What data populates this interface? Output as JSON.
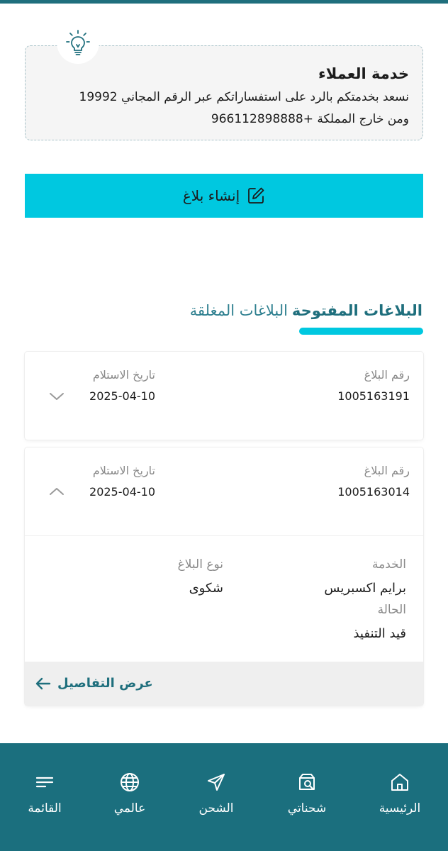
{
  "customer_service": {
    "title": "خدمة العملاء",
    "line1": "نسعد بخدمتكم بالرد على استفساراتكم عبر الرقم المجاني 19992",
    "line2": "ومن خارج المملكة +966112898888"
  },
  "create_button": {
    "label": "إنشاء بلاغ"
  },
  "tabs": [
    {
      "label": "البلاغات المفتوحة",
      "active": true
    },
    {
      "label": "البلاغات المغلقة",
      "active": false
    }
  ],
  "reports": [
    {
      "number_label": "رقم البلاغ",
      "number": "1005163191",
      "date_label": "تاريخ الاستلام",
      "date": "2025-04-10",
      "expanded": false
    },
    {
      "number_label": "رقم البلاغ",
      "number": "1005163014",
      "date_label": "تاريخ الاستلام",
      "date": "2025-04-10",
      "expanded": true,
      "service_label": "الخدمة",
      "service": "برايم اكسبريس",
      "type_label": "نوع البلاغ",
      "type": "شكوى",
      "status_label": "الحالة",
      "status": "قيد التنفيذ",
      "details_label": "عرض التفاصيل"
    }
  ],
  "bottom_nav": [
    {
      "label": "الرئيسية",
      "icon": "home-icon"
    },
    {
      "label": "شحناتي",
      "icon": "box-search-icon"
    },
    {
      "label": "الشحن",
      "icon": "send-icon"
    },
    {
      "label": "عالمي",
      "icon": "globe-icon"
    },
    {
      "label": "القائمة",
      "icon": "menu-icon"
    }
  ],
  "colors": {
    "primary": "#1f6f7d",
    "accent": "#00c8e0",
    "nav_background": "#1b6f7e"
  }
}
